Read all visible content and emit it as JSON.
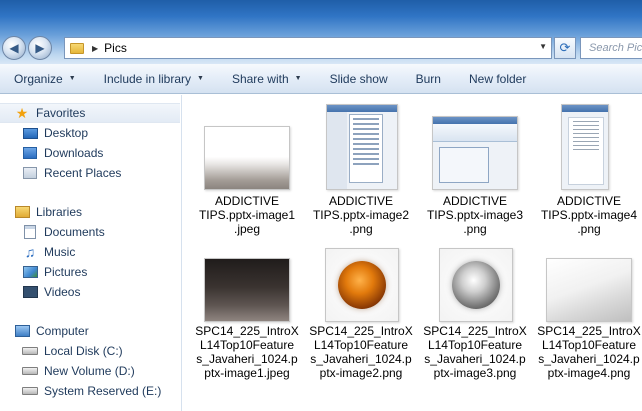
{
  "window": {
    "breadcrumb": "Pics",
    "search_placeholder": "Search Pics"
  },
  "toolbar": {
    "items": [
      {
        "label": "Organize",
        "dropdown": true
      },
      {
        "label": "Include in library",
        "dropdown": true
      },
      {
        "label": "Share with",
        "dropdown": true
      },
      {
        "label": "Slide show",
        "dropdown": false
      },
      {
        "label": "Burn",
        "dropdown": false
      },
      {
        "label": "New folder",
        "dropdown": false
      }
    ]
  },
  "navigation": {
    "favorites_label": "Favorites",
    "favorites": [
      "Desktop",
      "Downloads",
      "Recent Places"
    ],
    "libraries_label": "Libraries",
    "libraries": [
      "Documents",
      "Music",
      "Pictures",
      "Videos"
    ],
    "computer_label": "Computer",
    "drives": [
      "Local Disk (C:)",
      "New Volume (D:)",
      "System Reserved (E:)"
    ]
  },
  "files": [
    {
      "name": "ADDICTIVE TIPS.pptx-image1.jpeg",
      "lines": [
        "ADDICTIVE",
        "TIPS.pptx-image1",
        ".jpeg"
      ],
      "thumb": "white-gradient"
    },
    {
      "name": "ADDICTIVE TIPS.pptx-image2.png",
      "lines": [
        "ADDICTIVE",
        "TIPS.pptx-image2",
        ".png"
      ],
      "thumb": "screenshot-menu"
    },
    {
      "name": "ADDICTIVE TIPS.pptx-image3.png",
      "lines": [
        "ADDICTIVE",
        "TIPS.pptx-image3",
        ".png"
      ],
      "thumb": "screenshot-ribbon"
    },
    {
      "name": "ADDICTIVE TIPS.pptx-image4.png",
      "lines": [
        "ADDICTIVE",
        "TIPS.pptx-image4",
        ".png"
      ],
      "thumb": "screenshot-document"
    },
    {
      "name": "SPC14_225_IntroXL14Top10Features_Javaheri_1024.pptx-image1.jpeg",
      "lines": [
        "SPC14_225_IntroX",
        "L14Top10Feature",
        "s_Javaheri_1024.p",
        "ptx-image1.jpeg"
      ],
      "thumb": "dark-gradient"
    },
    {
      "name": "SPC14_225_IntroXL14Top10Features_Javaheri_1024.pptx-image2.png",
      "lines": [
        "SPC14_225_IntroX",
        "L14Top10Feature",
        "s_Javaheri_1024.p",
        "ptx-image2.png"
      ],
      "thumb": "orange-orb"
    },
    {
      "name": "SPC14_225_IntroXL14Top10Features_Javaheri_1024.pptx-image3.png",
      "lines": [
        "SPC14_225_IntroX",
        "L14Top10Feature",
        "s_Javaheri_1024.p",
        "ptx-image3.png"
      ],
      "thumb": "silver-orb"
    },
    {
      "name": "SPC14_225_IntroXL14Top10Features_Javaheri_1024.pptx-image4.png",
      "lines": [
        "SPC14_225_IntroX",
        "L14Top10Feature",
        "s_Javaheri_1024.p",
        "ptx-image4.png"
      ],
      "thumb": "gray-gradient"
    }
  ]
}
